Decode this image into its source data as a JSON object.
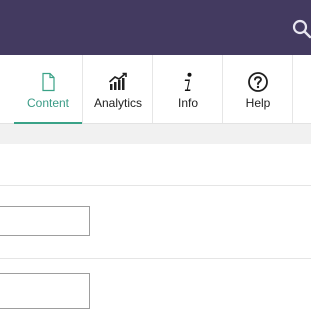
{
  "header": {
    "background": "#433a60",
    "search_icon": "search-icon"
  },
  "tabs": [
    {
      "label": "Content",
      "icon": "document-icon",
      "active": true
    },
    {
      "label": "Analytics",
      "icon": "bar-chart-trend-icon",
      "active": false
    },
    {
      "label": "Info",
      "icon": "info-icon",
      "active": false
    },
    {
      "label": "Help",
      "icon": "question-circle-icon",
      "active": false
    }
  ],
  "colors": {
    "accent": "#3aa287",
    "active_label": "#3a9b86"
  },
  "form": {
    "field_1": {
      "value": "",
      "placeholder": ""
    },
    "field_2": {
      "value": "",
      "placeholder": ""
    }
  }
}
